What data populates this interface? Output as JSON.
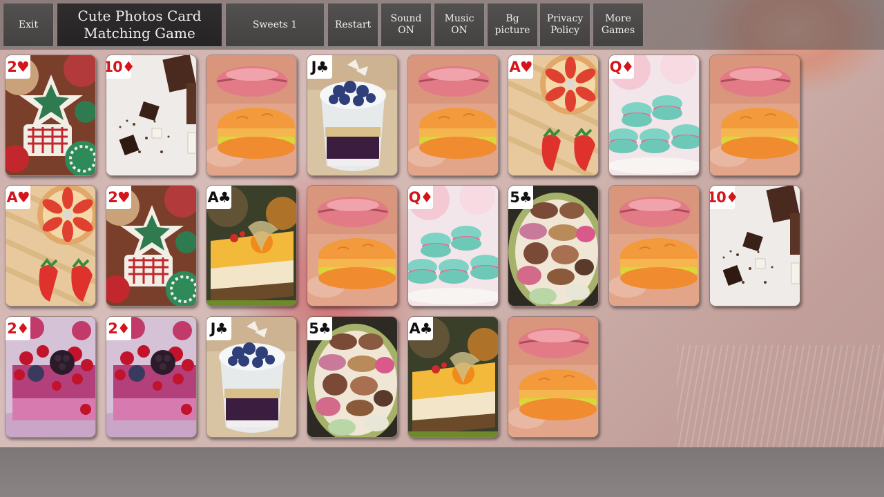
{
  "toolbar": {
    "exit_label": "Exit",
    "title": "Cute Photos Card\nMatching Game",
    "deck_label": "Sweets 1",
    "restart_label": "Restart",
    "sound_label": "Sound\nON",
    "music_label": "Music\nON",
    "bg_label": "Bg\npicture",
    "privacy_label": "Privacy\nPolicy",
    "more_label": "More\nGames"
  },
  "cards": [
    {
      "rank": "2",
      "suit": "♥",
      "color": "red",
      "photo": "christmas-cookies"
    },
    {
      "rank": "10",
      "suit": "♦",
      "color": "red",
      "photo": "chocolate-pieces"
    },
    {
      "rank": "",
      "suit": "",
      "color": "",
      "photo": "macaron-lips"
    },
    {
      "rank": "J",
      "suit": "♣",
      "color": "black",
      "photo": "blueberry-parfait"
    },
    {
      "rank": "",
      "suit": "",
      "color": "",
      "photo": "macaron-lips"
    },
    {
      "rank": "A",
      "suit": "♥",
      "color": "red",
      "photo": "strawberry-tart"
    },
    {
      "rank": "Q",
      "suit": "♦",
      "color": "red",
      "photo": "mint-macarons"
    },
    {
      "rank": "",
      "suit": "",
      "color": "",
      "photo": "macaron-lips"
    },
    {
      "rank": "A",
      "suit": "♥",
      "color": "red",
      "photo": "strawberry-tart"
    },
    {
      "rank": "2",
      "suit": "♥",
      "color": "red",
      "photo": "christmas-cookies"
    },
    {
      "rank": "A",
      "suit": "♣",
      "color": "black",
      "photo": "mango-cake"
    },
    {
      "rank": "",
      "suit": "",
      "color": "",
      "photo": "macaron-lips"
    },
    {
      "rank": "Q",
      "suit": "♦",
      "color": "red",
      "photo": "mint-macarons"
    },
    {
      "rank": "5",
      "suit": "♣",
      "color": "black",
      "photo": "macaron-bowl"
    },
    {
      "rank": "",
      "suit": "",
      "color": "",
      "photo": "macaron-lips"
    },
    {
      "rank": "10",
      "suit": "♦",
      "color": "red",
      "photo": "chocolate-pieces"
    },
    {
      "rank": "2",
      "suit": "♦",
      "color": "red",
      "photo": "berry-cake"
    },
    {
      "rank": "2",
      "suit": "♦",
      "color": "red",
      "photo": "berry-cake"
    },
    {
      "rank": "J",
      "suit": "♣",
      "color": "black",
      "photo": "blueberry-parfait"
    },
    {
      "rank": "5",
      "suit": "♣",
      "color": "black",
      "photo": "macaron-bowl"
    },
    {
      "rank": "A",
      "suit": "♣",
      "color": "black",
      "photo": "mango-cake"
    },
    {
      "rank": "",
      "suit": "",
      "color": "",
      "photo": "macaron-lips"
    }
  ],
  "colors": {
    "button_bg": "#4b4848",
    "title_bg": "#2a2828",
    "red_suit": "#d4151b",
    "black_suit": "#111111"
  }
}
